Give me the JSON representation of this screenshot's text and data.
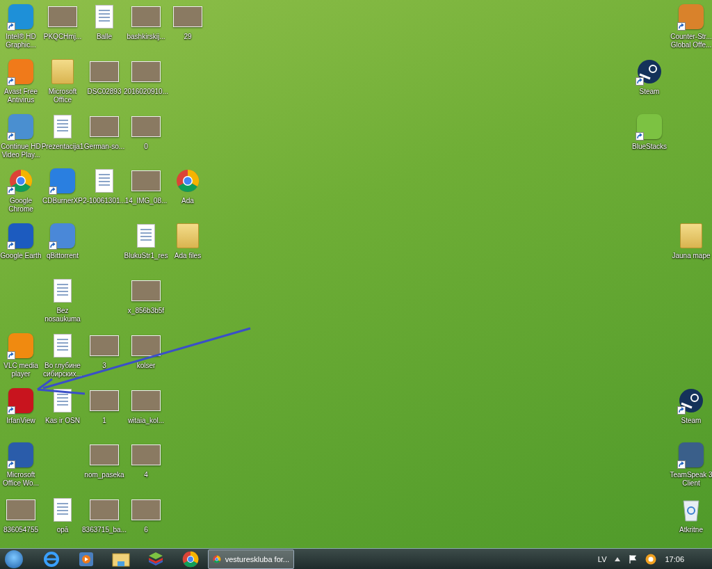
{
  "desktop": {
    "left_rows": [
      [
        {
          "label": "Intel® HD Graphic...",
          "kind": "app",
          "color": "#1e90d8",
          "shortcut": true
        },
        {
          "label": "PKQCHmj...",
          "kind": "photo",
          "shortcut": false
        },
        {
          "label": "Balle",
          "kind": "document",
          "shortcut": false
        },
        {
          "label": "bashkirskij...",
          "kind": "photo",
          "shortcut": false
        },
        {
          "label": "29",
          "kind": "photo",
          "shortcut": false
        }
      ],
      [
        {
          "label": "Avast Free Antivirus",
          "kind": "app",
          "color": "#f07a1a",
          "shortcut": true
        },
        {
          "label": "Microsoft Office",
          "kind": "folder",
          "shortcut": false
        },
        {
          "label": "DSC02893",
          "kind": "photo",
          "shortcut": false
        },
        {
          "label": "2016020910...",
          "kind": "photo",
          "shortcut": false
        },
        null
      ],
      [
        {
          "label": "Continue HD Video Play...",
          "kind": "app",
          "color": "#4a8fd0",
          "shortcut": true
        },
        {
          "label": "Prezentacija1",
          "kind": "document",
          "shortcut": false
        },
        {
          "label": "German-so...",
          "kind": "photo",
          "shortcut": false
        },
        {
          "label": "0",
          "kind": "photo",
          "shortcut": false
        },
        null
      ],
      [
        {
          "label": "Google Chrome",
          "kind": "chrome",
          "shortcut": true
        },
        {
          "label": "CDBurnerXP",
          "kind": "app",
          "color": "#2a7fe0",
          "shortcut": true
        },
        {
          "label": "2-10061301...",
          "kind": "document",
          "shortcut": false
        },
        {
          "label": "14_IMG_08...",
          "kind": "photo",
          "shortcut": false
        },
        {
          "label": "Ada",
          "kind": "chrome",
          "shortcut": false
        }
      ],
      [
        {
          "label": "Google Earth",
          "kind": "app",
          "color": "#1c5bbf",
          "shortcut": true
        },
        {
          "label": "qBittorrent",
          "kind": "app",
          "color": "#4a88d8",
          "shortcut": true
        },
        null,
        {
          "label": "BlukuStr1_res",
          "kind": "document",
          "shortcut": false
        },
        {
          "label": "Ada files",
          "kind": "folder",
          "shortcut": false
        }
      ],
      [
        null,
        {
          "label": "Bez nosaukuma",
          "kind": "document",
          "shortcut": false
        },
        null,
        {
          "label": "x_856b3b5f",
          "kind": "photo",
          "shortcut": false
        },
        null
      ],
      [
        {
          "label": "VLC media player",
          "kind": "app",
          "color": "#f08a10",
          "shortcut": true
        },
        {
          "label": "Во глубине сибирских...",
          "kind": "document",
          "shortcut": false
        },
        {
          "label": "3",
          "kind": "photo",
          "shortcut": false
        },
        {
          "label": "kolser",
          "kind": "photo",
          "shortcut": false
        },
        null
      ],
      [
        {
          "label": "IrfanView",
          "kind": "app",
          "color": "#c8141e",
          "shortcut": true
        },
        {
          "label": "Kas ir OSN",
          "kind": "document",
          "shortcut": false
        },
        {
          "label": "1",
          "kind": "photo",
          "shortcut": false
        },
        {
          "label": "witaia_kol...",
          "kind": "photo",
          "shortcut": false
        },
        null
      ],
      [
        {
          "label": "Microsoft Office Wo...",
          "kind": "app",
          "color": "#2a5caa",
          "shortcut": true
        },
        null,
        {
          "label": "nom_paseka",
          "kind": "photo",
          "shortcut": false
        },
        {
          "label": "4",
          "kind": "photo",
          "shortcut": false
        },
        null
      ],
      [
        {
          "label": "836054755",
          "kind": "photo",
          "shortcut": false
        },
        {
          "label": "opā",
          "kind": "document",
          "shortcut": false
        },
        {
          "label": "8363715_ba...",
          "kind": "photo",
          "shortcut": false
        },
        {
          "label": "6",
          "kind": "photo",
          "shortcut": false
        },
        null
      ]
    ],
    "right_rows": [
      [
        null,
        {
          "label": "Counter-Str... Global Offe...",
          "kind": "app",
          "color": "#d9822b",
          "shortcut": true
        }
      ],
      [
        {
          "label": "Steam",
          "kind": "steam",
          "shortcut": true
        },
        null
      ],
      [
        {
          "label": "BlueStacks",
          "kind": "app",
          "color": "#7cc242",
          "shortcut": true
        },
        null
      ],
      [
        null,
        null
      ],
      [
        null,
        {
          "label": "Jauna mape",
          "kind": "folder",
          "shortcut": false
        }
      ],
      [
        null,
        null
      ],
      [
        null,
        null
      ],
      [
        null,
        {
          "label": "Steam",
          "kind": "steam",
          "shortcut": true
        }
      ],
      [
        null,
        {
          "label": "TeamSpeak 3 Client",
          "kind": "app",
          "color": "#3a5f8a",
          "shortcut": true
        }
      ],
      [
        null,
        {
          "label": "Atkritne",
          "kind": "recycle-bin",
          "shortcut": false
        }
      ]
    ]
  },
  "taskbar": {
    "windows": [
      {
        "label": "vestureskluba for...",
        "selected": true
      }
    ],
    "tray": {
      "language": "LV",
      "clock": "17:06"
    }
  }
}
